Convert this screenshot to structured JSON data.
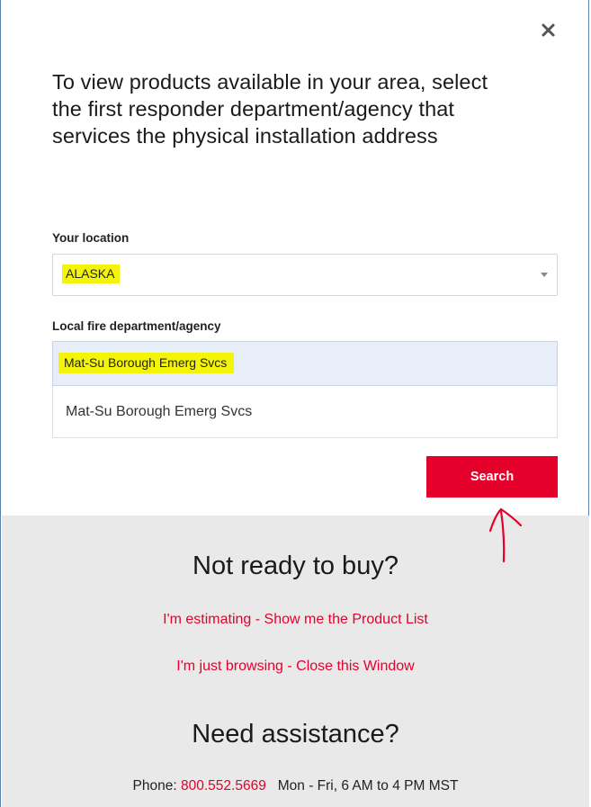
{
  "dialog": {
    "heading": "To view products available in your area, select the first responder department/agency that services the physical installation address",
    "close_icon": "close-icon"
  },
  "location": {
    "label": "Your location",
    "selected_value": "ALASKA"
  },
  "agency": {
    "label": "Local fire department/agency",
    "input_value": "Mat-Su Borough Emerg Svcs",
    "options": [
      "Mat-Su Borough Emerg Svcs"
    ]
  },
  "search_button": {
    "label": "Search"
  },
  "not_ready": {
    "heading": "Not ready to buy?",
    "links": [
      "I'm estimating - Show me the Product List",
      "I'm just browsing - Close this Window"
    ]
  },
  "assistance": {
    "heading": "Need assistance?",
    "phone_label": "Phone:",
    "phone_number": "800.552.5669",
    "hours": "Mon - Fri, 6 AM to 4 PM MST"
  },
  "colors": {
    "accent": "#e5002b",
    "highlight": "#f4f407",
    "gray_panel": "#e9e9e9",
    "input_focus_bg": "#e7eef8"
  }
}
